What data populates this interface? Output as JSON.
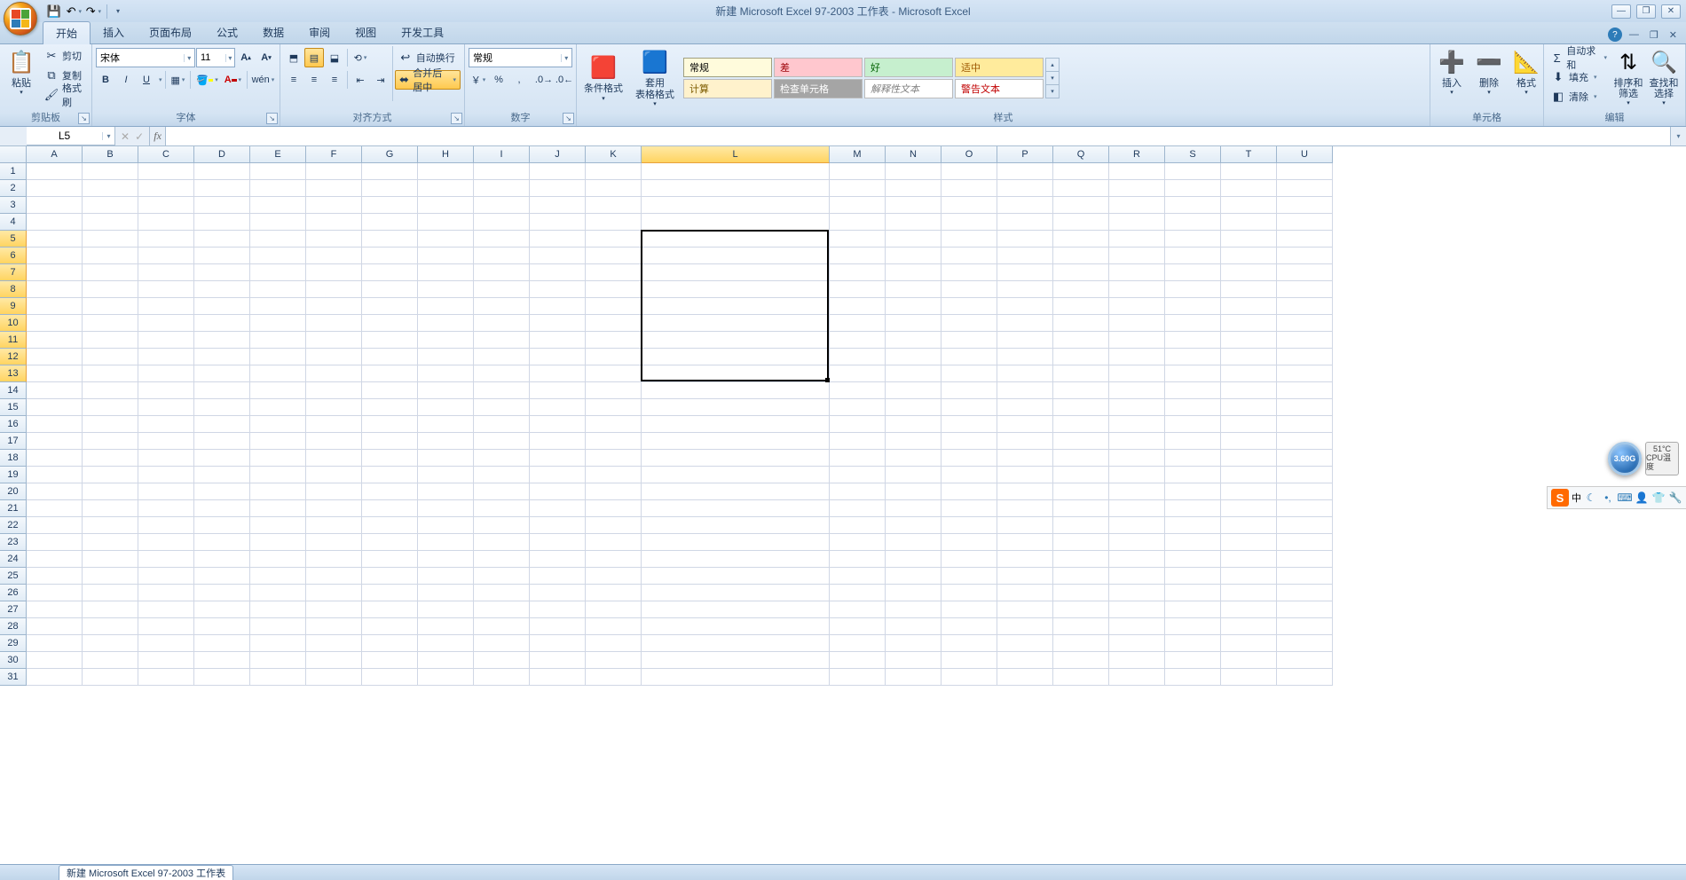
{
  "title": "新建 Microsoft Excel 97-2003 工作表 - Microsoft Excel",
  "qat": {
    "save": "保存",
    "undo": "撤销",
    "redo": "重做"
  },
  "tabs": [
    "开始",
    "插入",
    "页面布局",
    "公式",
    "数据",
    "审阅",
    "视图",
    "开发工具"
  ],
  "active_tab": 0,
  "groups": {
    "clipboard": {
      "label": "剪贴板",
      "paste": "粘贴",
      "cut": "剪切",
      "copy": "复制",
      "painter": "格式刷"
    },
    "font": {
      "label": "字体",
      "name": "宋体",
      "size": "11",
      "bold": "B",
      "italic": "I",
      "underline": "U"
    },
    "align": {
      "label": "对齐方式",
      "wrap": "自动换行",
      "merge": "合并后居中"
    },
    "number": {
      "label": "数字",
      "format": "常规"
    },
    "styles": {
      "label": "样式",
      "condfmt": "条件格式",
      "tblfmt": "套用\n表格格式",
      "cells": [
        "常规",
        "差",
        "好",
        "适中",
        "计算",
        "检查单元格",
        "解释性文本",
        "警告文本"
      ]
    },
    "cells": {
      "label": "单元格",
      "insert": "插入",
      "delete": "删除",
      "format": "格式"
    },
    "edit": {
      "label": "编辑",
      "autosum": "自动求和",
      "fill": "填充",
      "clear": "清除",
      "sortfilter": "排序和\n筛选",
      "findselect": "查找和\n选择"
    }
  },
  "namebox": "L5",
  "formula": "",
  "columns": [
    "A",
    "B",
    "C",
    "D",
    "E",
    "F",
    "G",
    "H",
    "I",
    "J",
    "K",
    "L",
    "M",
    "N",
    "O",
    "P",
    "Q",
    "R",
    "S",
    "T",
    "U"
  ],
  "col_widths": {
    "default": 63,
    "L": 212
  },
  "rows": 31,
  "selection": {
    "col": "L",
    "row_start": 5,
    "row_end": 13,
    "selected_rows": [
      5,
      6,
      7,
      8,
      9,
      10,
      11,
      12,
      13
    ]
  },
  "overlays": {
    "ghz": "3.60G",
    "cpu_temp_val": "51°C",
    "cpu_temp_lbl": "CPU温度",
    "ime_lang": "中",
    "ime_s": "S"
  },
  "sheet_tab": "新建 Microsoft Excel 97-2003 工作表"
}
